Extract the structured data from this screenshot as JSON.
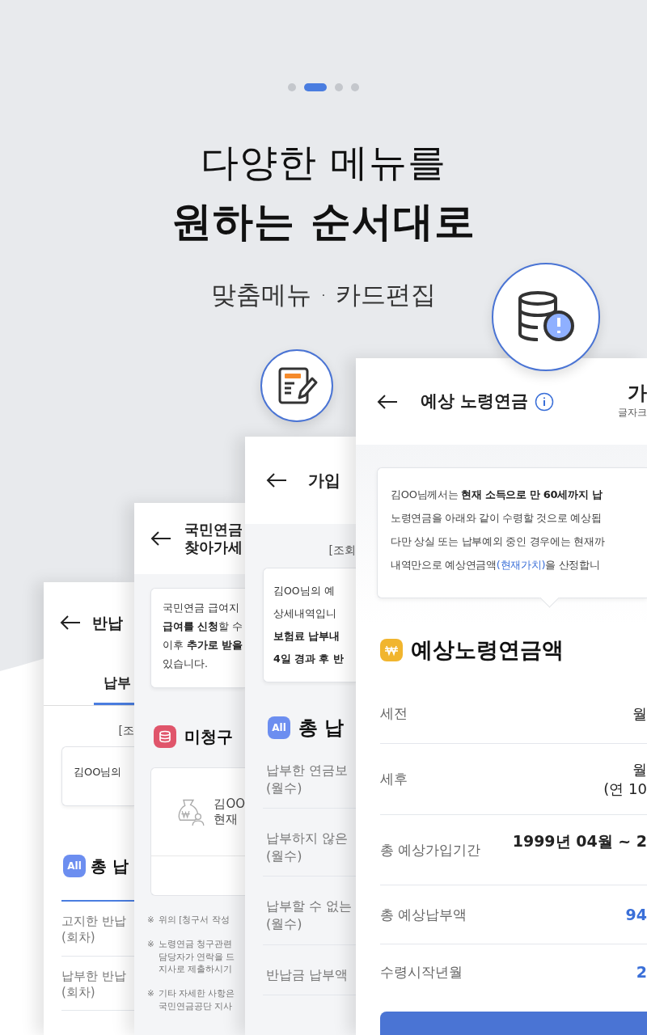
{
  "pagination": [
    {
      "selected": false
    },
    {
      "selected": true
    },
    {
      "selected": false
    },
    {
      "selected": false
    }
  ],
  "headline": {
    "line_1": "다양한 메뉴를",
    "line_2": "원하는 순서대로",
    "subtitle": "맞춤메뉴 · 카드편집"
  },
  "screens": [
    {
      "kind": "refund",
      "title": "반납",
      "tabs": [
        {
          "label": "납부",
          "selected": true
        }
      ],
      "query_note": "[조",
      "notice": [
        "김OO님의"
      ],
      "summary": {
        "badge": "All",
        "heading": "총 납"
      },
      "rows": [
        {
          "label": "고지한 반납",
          "unit": "(회차)"
        },
        {
          "label": "납부한 반납",
          "unit": "(회차)"
        }
      ]
    },
    {
      "kind": "unclaimed",
      "title": [
        "국민연금",
        "찾아가세"
      ],
      "notice": [
        "국민연금 급여지",
        "**급여를 신청**할 수",
        "이후 **추가로 받을**",
        "있습니다."
      ],
      "heading": "미청구",
      "card_lines": [
        "김OO",
        "현재"
      ],
      "notes": [
        {
          "mark": "※",
          "lines": [
            "위의 [청구서 작성"
          ]
        },
        {
          "mark": "※",
          "lines": [
            "노령연금 청구관련",
            "담당자가 연락을 드",
            "지사로 제출하시기"
          ]
        },
        {
          "mark": "※",
          "lines": [
            "기타 자세한 사항은",
            "국민연금공단 지사"
          ]
        }
      ]
    },
    {
      "kind": "enrollment",
      "title": "가입",
      "query_note": "[조회",
      "notice": [
        "김OO님의 예",
        "상세내역입니",
        "**보험료 납부내**",
        "**4일 경과 후 반**"
      ],
      "summary": {
        "badge": "All",
        "heading": "총 납"
      },
      "rows": [
        {
          "label": "납부한 연금보",
          "unit": "(월수)"
        },
        {
          "label": "납부하지 않은",
          "unit": "(월수)"
        },
        {
          "label": "납부할 수 없는",
          "unit": "(월수)"
        },
        {
          "label": "반납금 납부액"
        }
      ]
    },
    {
      "kind": "pension",
      "title": "예상 노령연금",
      "font_size": {
        "glyph": "가",
        "label": "글자크"
      },
      "tooltip": [
        "김OO님께서는 **현재 소득으로 만 60세까지 납**",
        "노령연금을 아래와 같이 수령할 것으로 예상됩",
        "다만 상실 또는 납부예외 중인 경우에는 현재까"
      ],
      "tooltip_last": {
        "before": "내역만으로 예상연금액",
        "link": "(현재가치)",
        "after": "을 산정합니"
      },
      "heading": "예상노령연금액",
      "rows": [
        {
          "label": "세전",
          "value": [
            "월"
          ],
          "kind": "plain"
        },
        {
          "label": "세후",
          "value": [
            "월",
            "(연 10"
          ],
          "kind": "plain"
        },
        {
          "label": "총 예상가입기간",
          "value": [
            "1999년 04월 ~ 2"
          ],
          "kind": "bold"
        },
        {
          "label": "총 예상납부액",
          "value": [
            "94"
          ],
          "kind": "accent"
        },
        {
          "label": "수령시작년월",
          "value": [
            "2"
          ],
          "kind": "accent"
        }
      ]
    }
  ]
}
